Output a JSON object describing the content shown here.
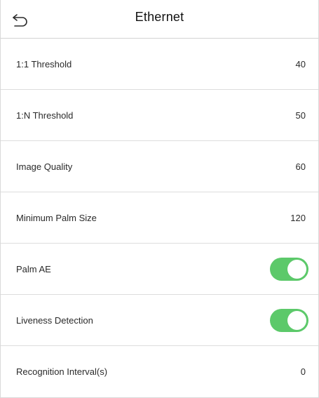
{
  "header": {
    "title": "Ethernet"
  },
  "settings": [
    {
      "label": "1:1 Threshold",
      "value": "40"
    },
    {
      "label": "1:N Threshold",
      "value": "50"
    },
    {
      "label": "Image Quality",
      "value": "60"
    },
    {
      "label": "Minimum Palm Size",
      "value": "120"
    },
    {
      "label": "Palm AE",
      "enabled": true
    },
    {
      "label": "Liveness Detection",
      "enabled": true
    },
    {
      "label": "Recognition Interval(s)",
      "value": "0"
    }
  ],
  "colors": {
    "toggle_on": "#5cc96a",
    "divider": "#dddddd",
    "text": "#2a2a2a"
  },
  "icons": {
    "back": "back-arrow-icon"
  }
}
